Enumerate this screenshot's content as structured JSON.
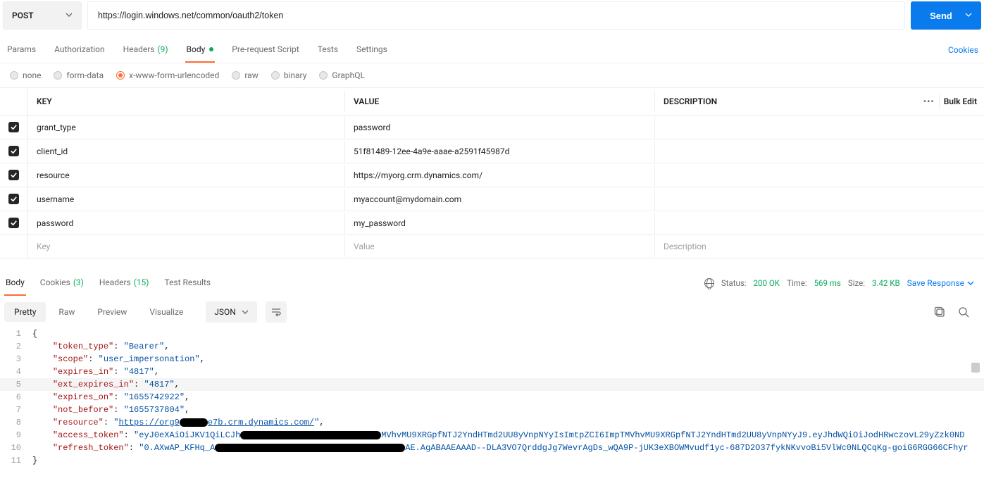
{
  "request": {
    "method": "POST",
    "url": "https://login.windows.net/common/oauth2/token",
    "send_label": "Send"
  },
  "tabs": {
    "params": "Params",
    "authorization": "Authorization",
    "headers": "Headers",
    "headers_count": "(9)",
    "body": "Body",
    "prerequest": "Pre-request Script",
    "tests": "Tests",
    "settings": "Settings",
    "cookies": "Cookies"
  },
  "body_types": {
    "none": "none",
    "formdata": "form-data",
    "xwww": "x-www-form-urlencoded",
    "raw": "raw",
    "binary": "binary",
    "graphql": "GraphQL"
  },
  "kv_headers": {
    "key": "KEY",
    "value": "VALUE",
    "description": "DESCRIPTION",
    "bulk": "Bulk Edit"
  },
  "kv_rows": [
    {
      "key": "grant_type",
      "value": "password",
      "desc": ""
    },
    {
      "key": "client_id",
      "value": "51f81489-12ee-4a9e-aaae-a2591f45987d",
      "desc": ""
    },
    {
      "key": "resource",
      "value": "https://myorg.crm.dynamics.com/",
      "desc": ""
    },
    {
      "key": "username",
      "value": "myaccount@mydomain.com",
      "desc": ""
    },
    {
      "key": "password",
      "value": "my_password",
      "desc": ""
    }
  ],
  "kv_placeholder": {
    "key": "Key",
    "value": "Value",
    "desc": "Description"
  },
  "response_tabs": {
    "body": "Body",
    "cookies": "Cookies",
    "cookies_count": "(3)",
    "headers": "Headers",
    "headers_count": "(15)",
    "tests": "Test Results"
  },
  "status": {
    "label": "Status:",
    "code": "200 OK",
    "time_label": "Time:",
    "time": "569 ms",
    "size_label": "Size:",
    "size": "3.42 KB",
    "save": "Save Response"
  },
  "view_tabs": {
    "pretty": "Pretty",
    "raw": "Raw",
    "preview": "Preview",
    "visualize": "Visualize",
    "format": "JSON"
  },
  "json_response": {
    "token_type_key": "\"token_type\"",
    "token_type_val": "\"Bearer\"",
    "scope_key": "\"scope\"",
    "scope_val": "\"user_impersonation\"",
    "expires_in_key": "\"expires_in\"",
    "expires_in_val": "\"4817\"",
    "ext_expires_in_key": "\"ext_expires_in\"",
    "ext_expires_in_val": "\"4817\"",
    "expires_on_key": "\"expires_on\"",
    "expires_on_val": "\"1655742922\"",
    "not_before_key": "\"not_before\"",
    "not_before_val": "\"1655737804\"",
    "resource_key": "\"resource\"",
    "resource_pre": "\"",
    "resource_url_a": "https://org9",
    "resource_url_b": "e7b.crm.dynamics.com/",
    "resource_post": "\"",
    "access_token_key": "\"access_token\"",
    "access_token_a": "\"eyJ0eXAiOiJKV1QiLCJh",
    "access_token_b": "MVhvMU9XRGpfNTJ2YndHTmd2UU8yVnpNYyIsImtpZCI6ImpTMVhvMU9XRGpfNTJ2YndHTmd2UU8yVnpNYyJ9.eyJhdWQiOiJodHRwczovL29yZzk0ND",
    "refresh_token_key": "\"refresh_token\"",
    "refresh_token_a": "\"0.AXwAP_KFHq_A",
    "refresh_token_b": "AE.AgABAAEAAAD--DLA3VO7QrddgJg7WevrAgDs_wQA9P-jUK3eXBOWMvudf1yc-687D2O37fykNKvvoBi5VlWc0NLQCqKg-goiG6RGG66CFhyr"
  }
}
